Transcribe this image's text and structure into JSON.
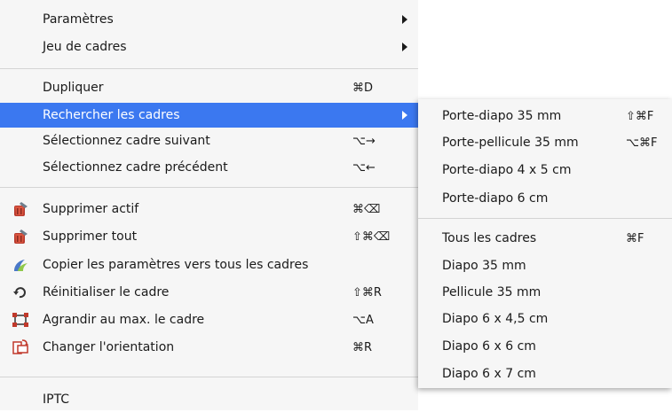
{
  "menu": {
    "parametres": {
      "label": "Paramètres"
    },
    "jeu_de_cadres": {
      "label": "Jeu de cadres"
    },
    "dupliquer": {
      "label": "Dupliquer",
      "shortcut": "⌘D"
    },
    "rechercher": {
      "label": "Rechercher les cadres"
    },
    "suivant": {
      "label": "Sélectionnez cadre suivant",
      "shortcut": "⌥→"
    },
    "precedent": {
      "label": "Sélectionnez cadre précédent",
      "shortcut": "⌥←"
    },
    "supprimer_actif": {
      "label": "Supprimer actif",
      "shortcut": "⌘⌫",
      "icon": "trash-icon"
    },
    "supprimer_tout": {
      "label": "Supprimer tout",
      "shortcut": "⇧⌘⌫",
      "icon": "trash-icon"
    },
    "copier": {
      "label": "Copier les paramètres vers tous les cadres",
      "icon": "copy-params-icon"
    },
    "reinitialiser": {
      "label": "Réinitialiser le cadre",
      "shortcut": "⇧⌘R",
      "icon": "reset-icon"
    },
    "agrandir": {
      "label": "Agrandir au max. le cadre",
      "shortcut": "⌥A",
      "icon": "maximize-frame-icon"
    },
    "orientation": {
      "label": "Changer l'orientation",
      "shortcut": "⌘R",
      "icon": "rotate-orientation-icon"
    },
    "iptc": {
      "label": "IPTC"
    }
  },
  "submenu": {
    "porte_diapo_35": {
      "label": "Porte-diapo 35 mm",
      "shortcut": "⇧⌘F"
    },
    "porte_pellicule_35": {
      "label": "Porte-pellicule 35 mm",
      "shortcut": "⌥⌘F"
    },
    "porte_diapo_4x5": {
      "label": "Porte-diapo 4 x 5 cm"
    },
    "porte_diapo_6": {
      "label": "Porte-diapo 6 cm"
    },
    "tous": {
      "label": "Tous les cadres",
      "shortcut": "⌘F"
    },
    "diapo_35": {
      "label": "Diapo 35 mm"
    },
    "pellicule_35": {
      "label": "Pellicule 35 mm"
    },
    "diapo_6x45": {
      "label": "Diapo 6 x 4,5 cm"
    },
    "diapo_6x6": {
      "label": "Diapo 6 x 6 cm"
    },
    "diapo_6x7": {
      "label": "Diapo 6 x 7 cm"
    }
  },
  "colors": {
    "highlight": "#3b78f0",
    "menu_bg": "#f6f6f6",
    "separator": "#d4d4d4"
  }
}
